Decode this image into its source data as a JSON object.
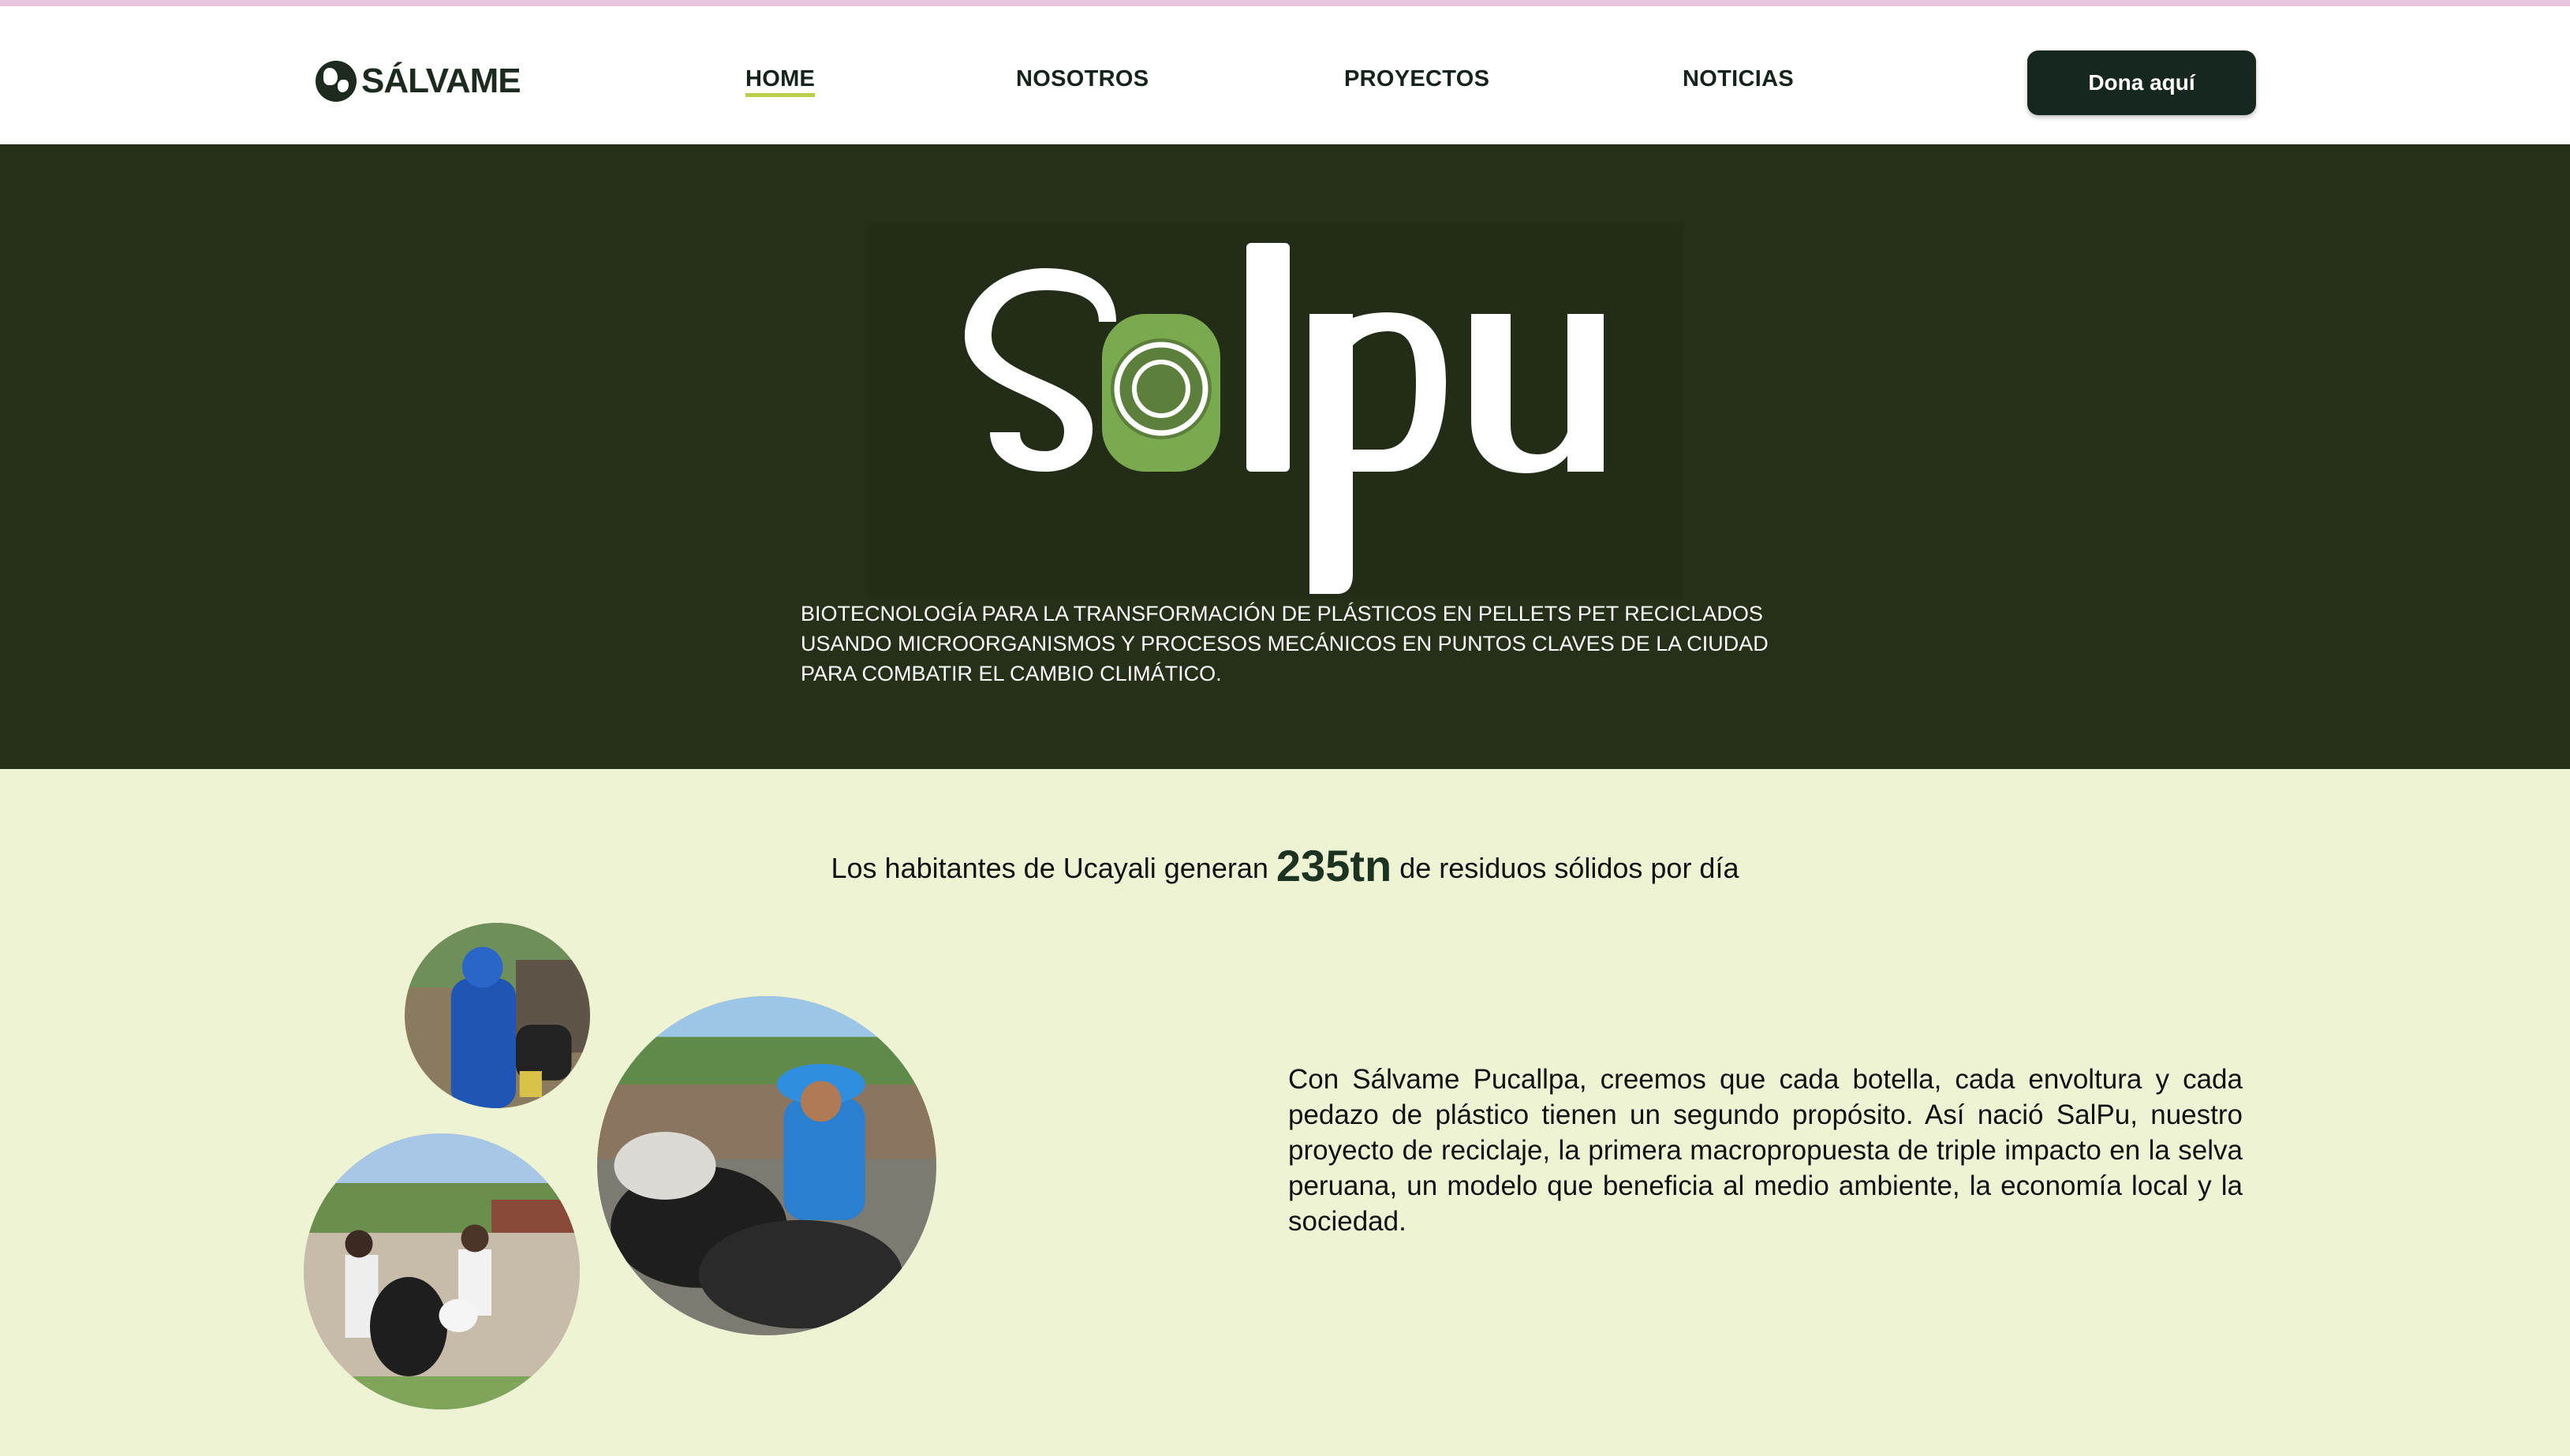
{
  "brand": {
    "name": "SÁLVAME",
    "accent": "#b8cf4a",
    "dark": "#16271d",
    "hero_bg": "#263018",
    "page_bg": "#eef3d4"
  },
  "nav": {
    "items": [
      {
        "label": "HOME",
        "active": true
      },
      {
        "label": "NOSOTROS",
        "active": false
      },
      {
        "label": "PROYECTOS",
        "active": false
      },
      {
        "label": "NOTICIAS",
        "active": false
      }
    ],
    "donate_label": "Dona aquí"
  },
  "hero": {
    "logo_text": "Salpu",
    "description": "BIOTECNOLOGÍA PARA LA TRANSFORMACIÓN DE PLÁSTICOS EN PELLETS PET RECICLADOS USANDO MICROORGANISMOS Y PROCESOS MECÁNICOS EN PUNTOS CLAVES DE LA CIUDAD PARA COMBATIR EL CAMBIO CLIMÁTICO."
  },
  "stat": {
    "prefix": "Los habitantes de Ucayali generan",
    "value": "235tn",
    "suffix": "de residuos sólidos por día"
  },
  "about": {
    "text": "Con Sálvame Pucallpa, creemos que cada botella, cada envoltura y cada pedazo de plástico tienen un segundo propósito. Así nació SalPu, nuestro proyecto de reciclaje, la primera macropropuesta de triple impacto en la selva peruana, un modelo que beneficia al medio ambiente, la economía local y la sociedad."
  },
  "photos": [
    {
      "icon": "photo-worker-blue-suit"
    },
    {
      "icon": "photo-worker-sorting-bags"
    },
    {
      "icon": "photo-residents-street-bags"
    }
  ]
}
